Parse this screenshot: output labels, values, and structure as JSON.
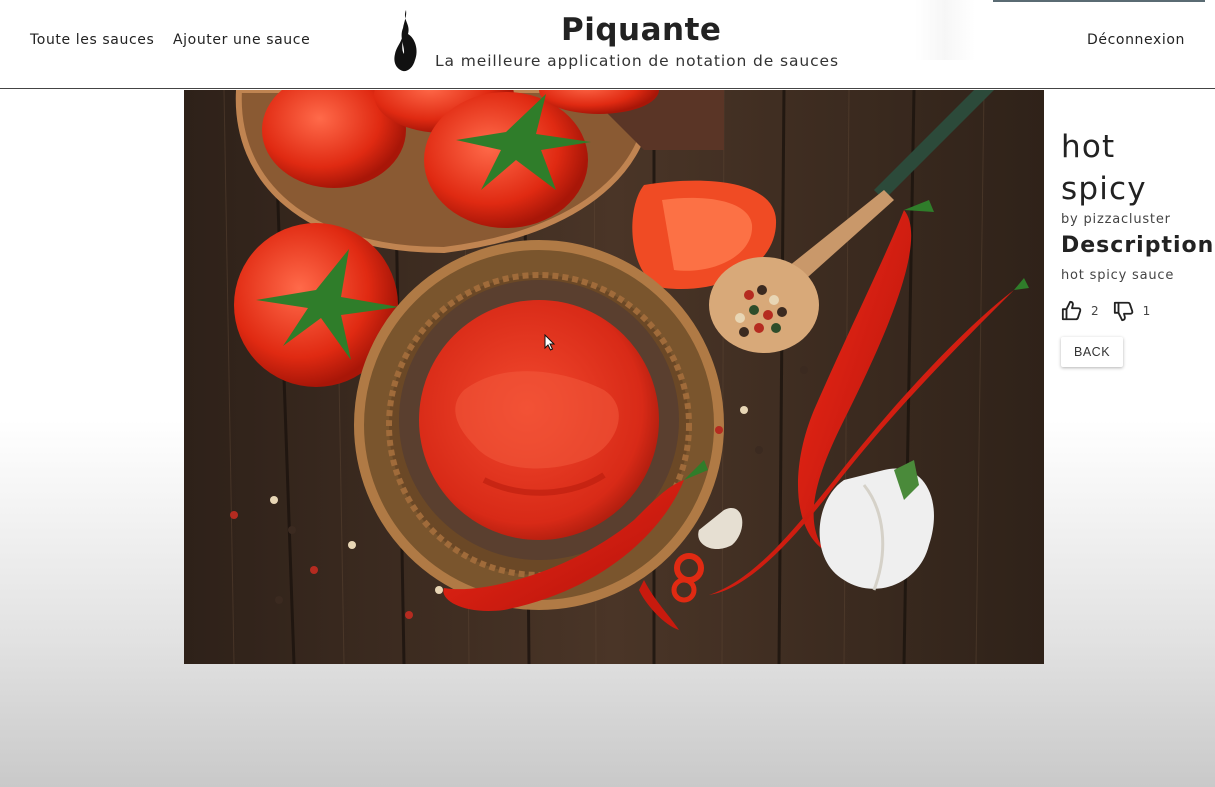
{
  "header": {
    "nav_all": "Toute les sauces",
    "nav_add": "Ajouter une sauce",
    "title": "Piquante",
    "subtitle": "La meilleure application de notation de sauces",
    "logout": "Déconnexion"
  },
  "sauce": {
    "name": "hot spicy",
    "author": "by pizzacluster",
    "description_heading": "Description",
    "description": "hot spicy sauce",
    "likes": "2",
    "dislikes": "1"
  },
  "actions": {
    "back_label": "BACK"
  },
  "icons": {
    "like": "thumbs-up-icon",
    "dislike": "thumbs-down-icon",
    "logo": "flame-icon"
  },
  "colors": {
    "accent": "#222222",
    "header_border": "#444444"
  }
}
